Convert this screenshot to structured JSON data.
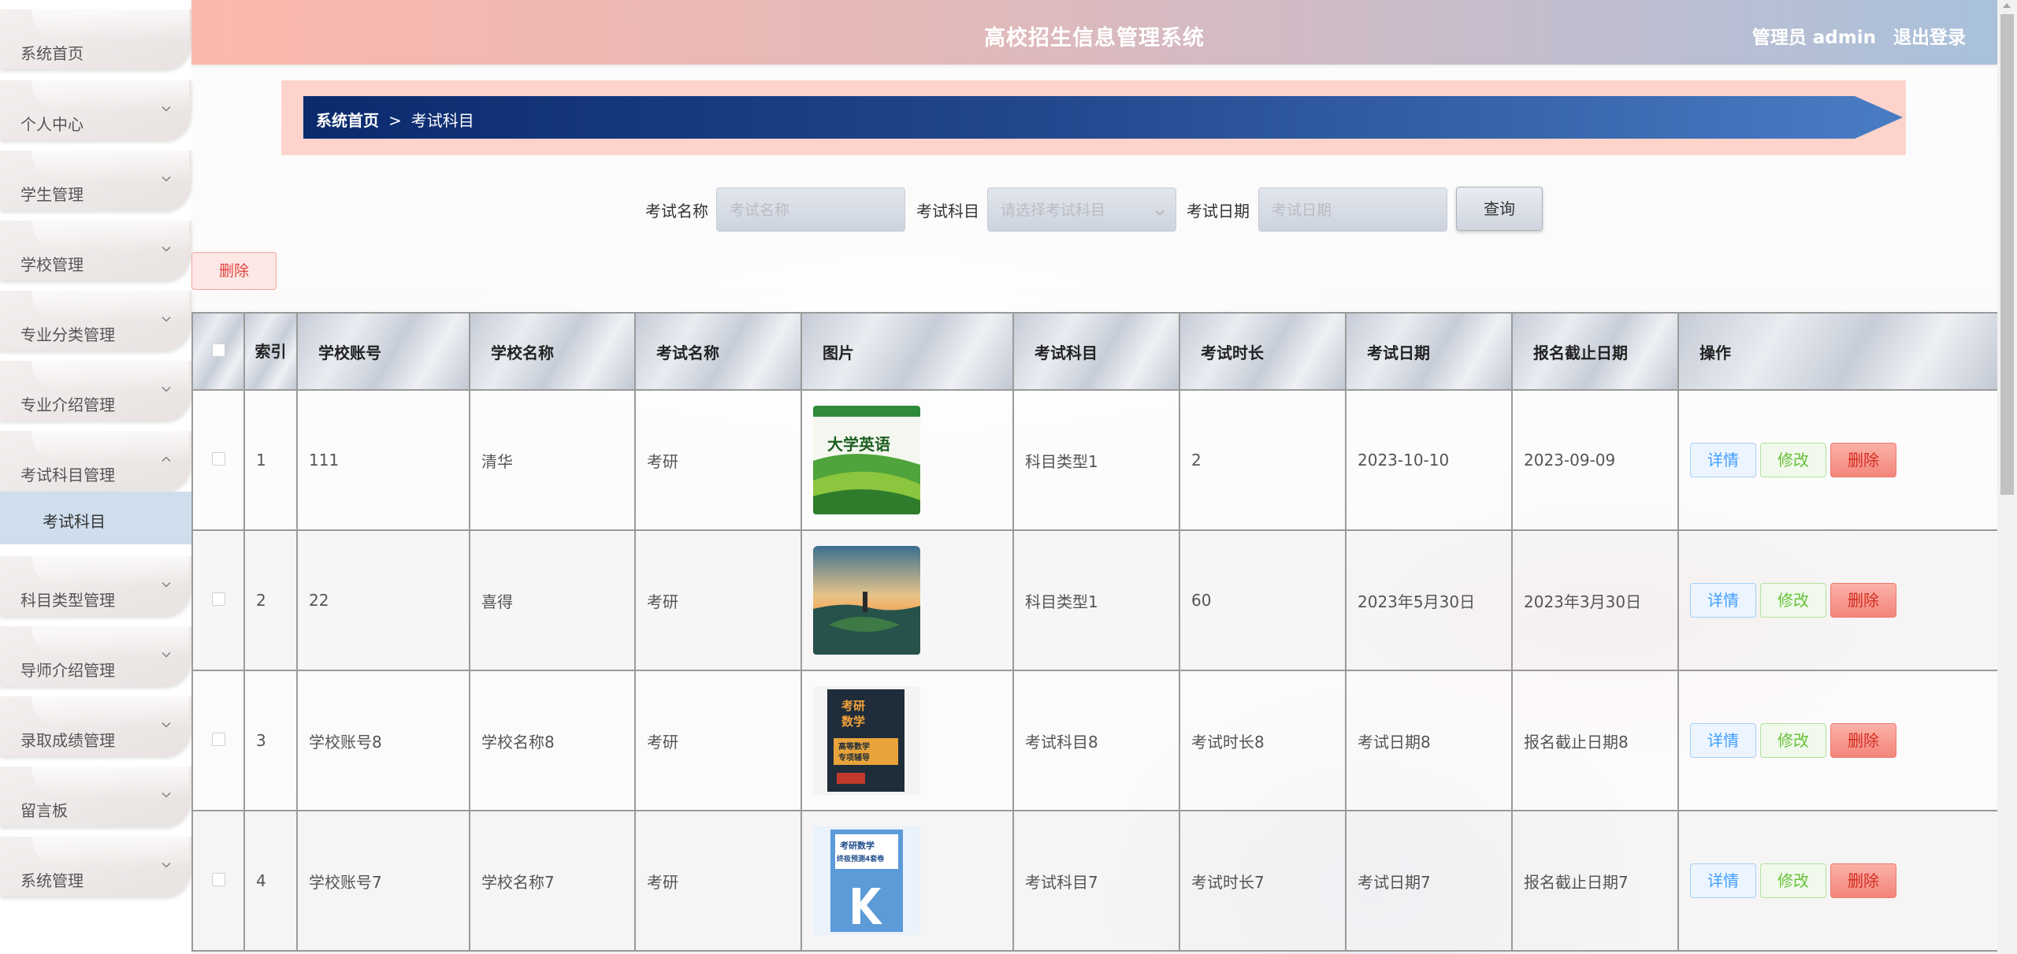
{
  "header": {
    "title": "高校招生信息管理系统",
    "user": "管理员 admin",
    "logout": "退出登录"
  },
  "sidebar": {
    "items": [
      {
        "label": "系统首页",
        "icon": "none"
      },
      {
        "label": "个人中心",
        "icon": "chevron-down-icon"
      },
      {
        "label": "学生管理",
        "icon": "chevron-down-icon"
      },
      {
        "label": "学校管理",
        "icon": "chevron-down-icon"
      },
      {
        "label": "专业分类管理",
        "icon": "chevron-down-icon"
      },
      {
        "label": "专业介绍管理",
        "icon": "chevron-down-icon"
      },
      {
        "label": "考试科目管理",
        "icon": "chevron-up-icon"
      },
      {
        "label": "科目类型管理",
        "icon": "chevron-down-icon"
      },
      {
        "label": "导师介绍管理",
        "icon": "chevron-down-icon"
      },
      {
        "label": "录取成绩管理",
        "icon": "chevron-down-icon"
      },
      {
        "label": "留言板",
        "icon": "chevron-down-icon"
      },
      {
        "label": "系统管理",
        "icon": "chevron-down-icon"
      }
    ],
    "active_sub": "考试科目"
  },
  "breadcrumb": {
    "home": "系统首页",
    "separator": ">",
    "current": "考试科目"
  },
  "search": {
    "name_label": "考试名称",
    "name_placeholder": "考试名称",
    "subject_label": "考试科目",
    "subject_placeholder": "请选择考试科目",
    "date_label": "考试日期",
    "date_placeholder": "考试日期",
    "query_button": "查询"
  },
  "bulk_delete": "删除",
  "table": {
    "headers": [
      "",
      "索引",
      "学校账号",
      "学校名称",
      "考试名称",
      "图片",
      "考试科目",
      "考试时长",
      "考试日期",
      "报名截止日期",
      "操作"
    ],
    "rows": [
      {
        "index": "1",
        "account": "111",
        "school": "清华",
        "exam": "考研",
        "image": "english-book-cover",
        "subject": "科目类型1",
        "duration": "2",
        "date": "2023-10-10",
        "deadline": "2023-09-09"
      },
      {
        "index": "2",
        "account": "22",
        "school": "喜得",
        "exam": "考研",
        "image": "landscape-photo",
        "subject": "科目类型1",
        "duration": "60",
        "date": "2023年5月30日",
        "deadline": "2023年3月30日"
      },
      {
        "index": "3",
        "account": "学校账号8",
        "school": "学校名称8",
        "exam": "考研",
        "image": "math-book-cover",
        "subject": "考试科目8",
        "duration": "考试时长8",
        "date": "考试日期8",
        "deadline": "报名截止日期8"
      },
      {
        "index": "4",
        "account": "学校账号7",
        "school": "学校名称7",
        "exam": "考研",
        "image": "math-exam-book-cover",
        "subject": "考试科目7",
        "duration": "考试时长7",
        "date": "考试日期7",
        "deadline": "报名截止日期7"
      }
    ],
    "actions": {
      "detail": "详情",
      "edit": "修改",
      "delete": "删除"
    }
  },
  "thumb_text": {
    "english_title": "大学英语",
    "math_line1": "考研",
    "math_line2": "数学",
    "math_line3": "高等数学",
    "math_line4": "专项辅导",
    "exam_line1": "考研数学",
    "exam_line2": "终极预测4套卷"
  },
  "colors": {
    "header_start": "#fbb8ad",
    "header_end": "#a9c1db",
    "crumb_start": "#0b2a6e",
    "crumb_end": "#4a7cc4",
    "submenu_active": "#cfdeed"
  }
}
